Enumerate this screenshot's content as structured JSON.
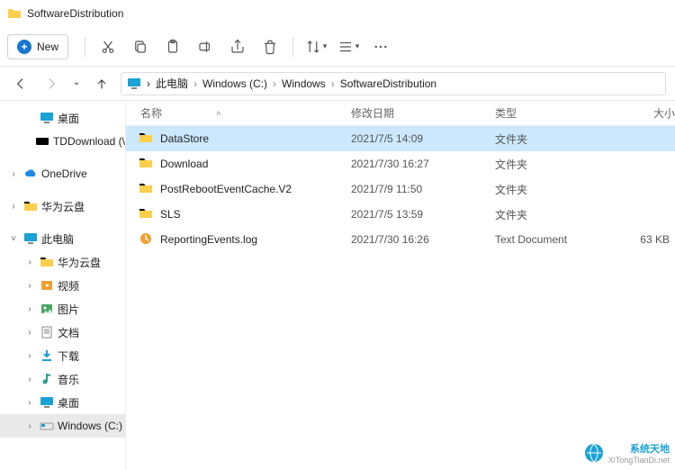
{
  "window": {
    "title": "SoftwareDistribution"
  },
  "toolbar": {
    "new_label": "New"
  },
  "breadcrumbs": {
    "items": [
      {
        "label": "此电脑"
      },
      {
        "label": "Windows (C:)"
      },
      {
        "label": "Windows"
      },
      {
        "label": "SoftwareDistribution"
      }
    ]
  },
  "sidebar": {
    "items": [
      {
        "label": "桌面",
        "icon": "monitor",
        "depth": 1
      },
      {
        "label": "TDDownload (\\",
        "icon": "disk",
        "depth": 1
      },
      {
        "label": "OneDrive",
        "icon": "cloud",
        "depth": 0,
        "twisty": ">"
      },
      {
        "label": "华为云盘",
        "icon": "folder",
        "depth": 0,
        "twisty": ">"
      },
      {
        "label": "此电脑",
        "icon": "monitor",
        "depth": 0,
        "twisty": "v"
      },
      {
        "label": "华为云盘",
        "icon": "folder",
        "depth": 1,
        "twisty": ">"
      },
      {
        "label": "视频",
        "icon": "video",
        "depth": 1,
        "twisty": ">"
      },
      {
        "label": "图片",
        "icon": "picture",
        "depth": 1,
        "twisty": ">"
      },
      {
        "label": "文档",
        "icon": "document",
        "depth": 1,
        "twisty": ">"
      },
      {
        "label": "下载",
        "icon": "download",
        "depth": 1,
        "twisty": ">"
      },
      {
        "label": "音乐",
        "icon": "music",
        "depth": 1,
        "twisty": ">"
      },
      {
        "label": "桌面",
        "icon": "monitor",
        "depth": 1,
        "twisty": ">"
      },
      {
        "label": "Windows (C:)",
        "icon": "drive",
        "depth": 1,
        "twisty": ">",
        "selected": true
      }
    ]
  },
  "columns": {
    "name": "名称",
    "date": "修改日期",
    "type": "类型",
    "size": "大小"
  },
  "rows": [
    {
      "name": "DataStore",
      "date": "2021/7/5 14:09",
      "type": "文件夹",
      "size": "",
      "icon": "folder",
      "selected": true
    },
    {
      "name": "Download",
      "date": "2021/7/30 16:27",
      "type": "文件夹",
      "size": "",
      "icon": "folder"
    },
    {
      "name": "PostRebootEventCache.V2",
      "date": "2021/7/9 11:50",
      "type": "文件夹",
      "size": "",
      "icon": "folder"
    },
    {
      "name": "SLS",
      "date": "2021/7/5 13:59",
      "type": "文件夹",
      "size": "",
      "icon": "folder"
    },
    {
      "name": "ReportingEvents.log",
      "date": "2021/7/30 16:26",
      "type": "Text Document",
      "size": "63 KB",
      "icon": "log"
    }
  ],
  "watermark": {
    "brand": "系统天地",
    "url": "XiTongTianDi.net"
  }
}
